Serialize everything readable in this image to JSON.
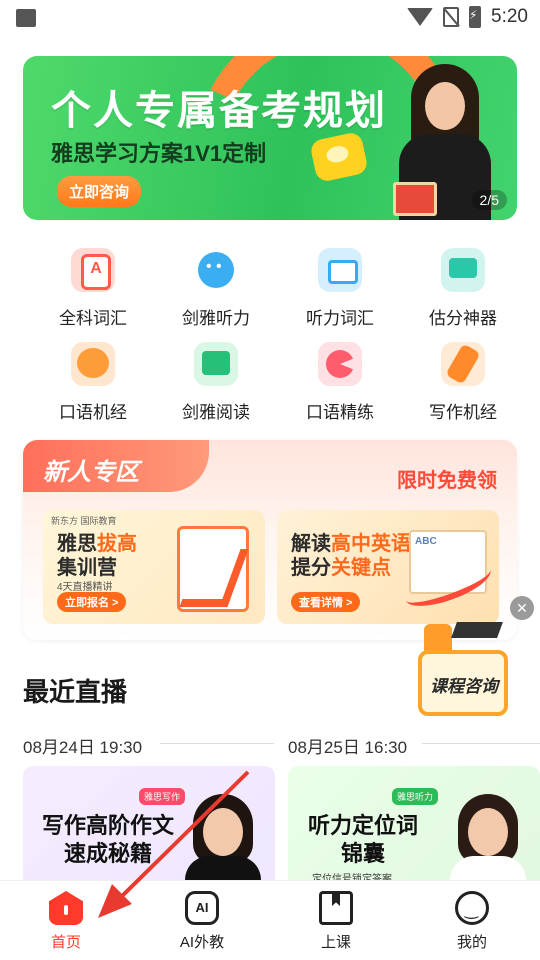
{
  "status_bar": {
    "time": "5:20"
  },
  "banner": {
    "title": "个人专属备考规划",
    "subtitle": "雅思学习方案1V1定制",
    "cta": "立即咨询",
    "pager": "2/5"
  },
  "features": [
    {
      "label": "全科词汇",
      "icon": "vocab-icon"
    },
    {
      "label": "剑雅听力",
      "icon": "listening-icon"
    },
    {
      "label": "听力词汇",
      "icon": "listening-vocab-icon"
    },
    {
      "label": "估分神器",
      "icon": "score-estimate-icon"
    },
    {
      "label": "口语机经",
      "icon": "speaking-icon"
    },
    {
      "label": "剑雅阅读",
      "icon": "reading-icon"
    },
    {
      "label": "口语精练",
      "icon": "speaking-practice-icon"
    },
    {
      "label": "写作机经",
      "icon": "writing-icon"
    }
  ],
  "promo": {
    "tag": "新人专区",
    "free": "限时免费领",
    "card1": {
      "logo": "新东方 国际教育",
      "title_a": "雅思",
      "title_hl": "拔高",
      "title_b": "集训营",
      "mini": "4天直播精讲",
      "btn": "立即报名 >"
    },
    "card2": {
      "title_a": "解读",
      "title_hl1": "高中英语",
      "title_b": "提分",
      "title_hl2": "关键点",
      "btn": "查看详情 >"
    }
  },
  "float_badge": "课程咨询",
  "live": {
    "title": "最近直播",
    "date1": "08月24日 19:30",
    "date2": "08月25日 16:30",
    "card1": {
      "badge": "雅思写作",
      "title": "写作高阶作文速成秘籍"
    },
    "card2": {
      "badge": "雅思听力",
      "title": "听力定位词锦囊",
      "sub": "定位信号锁定答案"
    }
  },
  "tabs": [
    {
      "label": "首页",
      "icon": "home-icon"
    },
    {
      "label": "AI外教",
      "icon": "ai-tutor-icon"
    },
    {
      "label": "上课",
      "icon": "class-icon"
    },
    {
      "label": "我的",
      "icon": "profile-icon"
    }
  ],
  "colors": {
    "accent": "#ff3a2a",
    "banner_green": "#2fc25a"
  }
}
